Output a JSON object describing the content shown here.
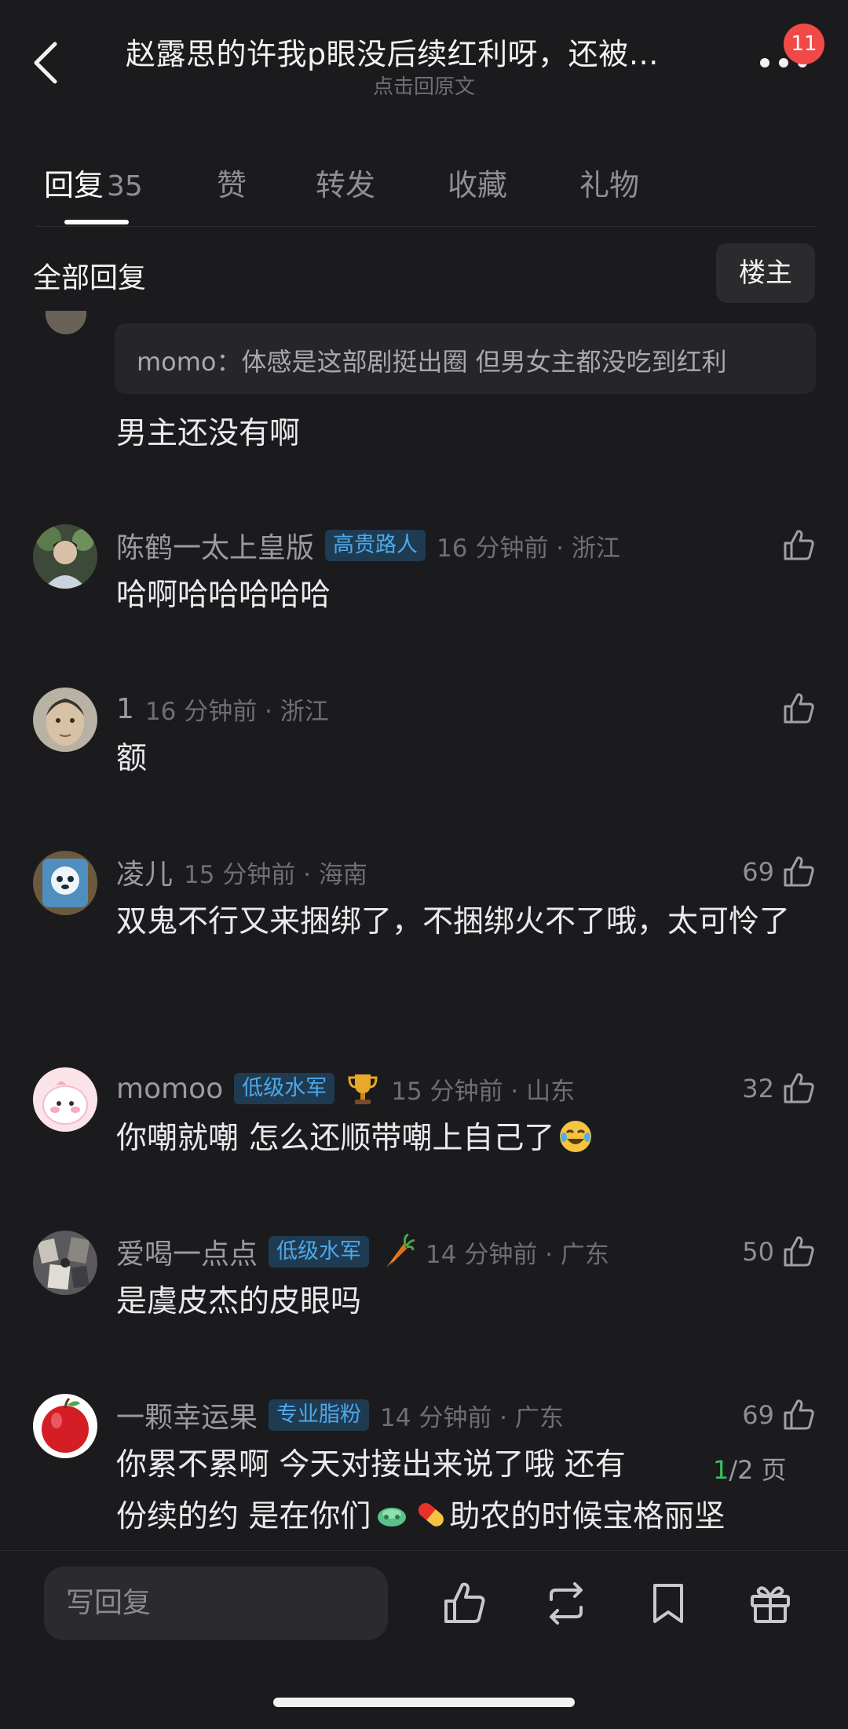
{
  "header": {
    "title": "赵露思的许我p眼没后续红利呀，还被…",
    "subtitle": "点击回原文",
    "notification_count": "11"
  },
  "tabs": [
    {
      "label": "回复",
      "count": "35"
    },
    {
      "label": "赞"
    },
    {
      "label": "转发"
    },
    {
      "label": "收藏"
    },
    {
      "label": "礼物"
    }
  ],
  "section": {
    "title": "全部回复",
    "owner_button": "楼主"
  },
  "first_reply": {
    "quote": "momo：体感是这部剧挺出圈 但男女主都没吃到红利",
    "text": "男主还没有啊"
  },
  "comments": [
    {
      "username": "陈鹤一太上皇版",
      "tag": "高贵路人",
      "time": "16 分钟前 · 浙江",
      "likes": "",
      "text": "哈啊哈哈哈哈哈"
    },
    {
      "username": "1",
      "time": "16 分钟前 · 浙江",
      "likes": "",
      "text": "额"
    },
    {
      "username": "凌儿",
      "time": "15 分钟前 · 海南",
      "likes": "69",
      "text": "双鬼不行又来捆绑了，不捆绑火不了哦，太可怜了"
    },
    {
      "username": "momoo",
      "tag": "低级水军",
      "badge_icon": "trophy-icon",
      "time": "15 分钟前 · 山东",
      "likes": "32",
      "text": "你嘲就嘲 怎么还顺带嘲上自己了",
      "emoji": "laughing-crying-emoji"
    },
    {
      "username": "爱喝一点点",
      "tag": "低级水军",
      "badge_icon": "carrot-icon",
      "time": "14 分钟前 · 广东",
      "likes": "50",
      "text": "是虞皮杰的皮眼吗"
    },
    {
      "username": "一颗幸运果",
      "tag": "专业脂粉",
      "time": "14 分钟前 · 广东",
      "likes": "69",
      "text_line1": "你累不累啊 今天对接出来说了哦 还有",
      "text_line2": "份续的约 是在你们",
      "text_line2_end": "助农的时候宝格丽坚"
    }
  ],
  "page_indicator": {
    "current": "1",
    "total": "/2 页"
  },
  "bottom_bar": {
    "reply_placeholder": "写回复",
    "icons": [
      "like-icon",
      "repost-icon",
      "bookmark-icon",
      "gift-icon"
    ]
  },
  "colors": {
    "background": "#1b1b1d",
    "tag_bg": "#1f3b52",
    "tag_text": "#4ea8e8",
    "badge": "#f04a48",
    "page_current": "#3dbf5e"
  }
}
